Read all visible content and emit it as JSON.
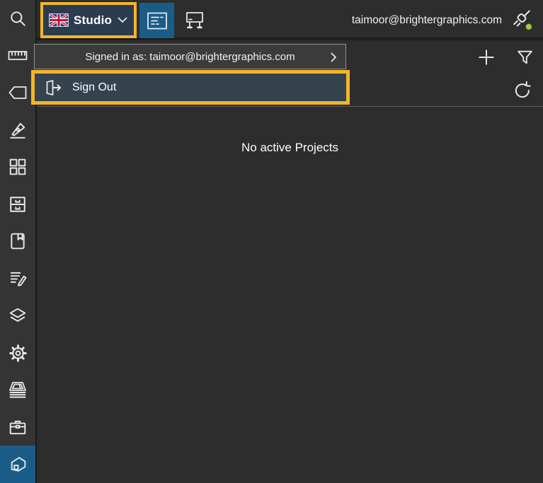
{
  "colors": {
    "bg": "#2d2d2d",
    "sidebar_bg": "#343434",
    "active_blue": "#1a5c88",
    "highlight": "#f2b62c",
    "menu_row_bg": "#3b3b3b",
    "signout_bg": "#35434e",
    "studio_btn_bg": "#2b3c4f",
    "status_green": "#9ccc3c"
  },
  "sidebar": {
    "items": [
      {
        "icon": "search-icon"
      },
      {
        "icon": "ruler-icon"
      },
      {
        "icon": "tag-icon"
      },
      {
        "icon": "pen-tool-icon"
      },
      {
        "icon": "grid-icon"
      },
      {
        "icon": "drawer-icon"
      },
      {
        "icon": "bookmark-icon"
      },
      {
        "icon": "edit-document-icon"
      },
      {
        "icon": "layers-icon"
      },
      {
        "icon": "settings-gear-icon"
      },
      {
        "icon": "press-output-icon"
      },
      {
        "icon": "toolbox-icon"
      },
      {
        "icon": "home-icon",
        "active": true
      }
    ]
  },
  "topbar": {
    "studio": {
      "label": "Studio",
      "flag": "uk-flag-icon",
      "chevron": "chevron-down-icon"
    },
    "view_buttons": [
      {
        "icon": "form-view-icon",
        "active": true
      },
      {
        "icon": "whiteboard-icon",
        "active": false
      }
    ],
    "email": "taimoor@brightergraphics.com",
    "connection": {
      "icon": "plug-icon",
      "status": "connected"
    }
  },
  "account_menu": {
    "signed_in_as": "Signed in as: taimoor@brightergraphics.com",
    "sign_out": "Sign Out"
  },
  "project_toolbar": {
    "add": "add-project",
    "filter": "filter-projects",
    "refresh": "refresh-projects"
  },
  "content": {
    "empty_message": "No active Projects"
  }
}
